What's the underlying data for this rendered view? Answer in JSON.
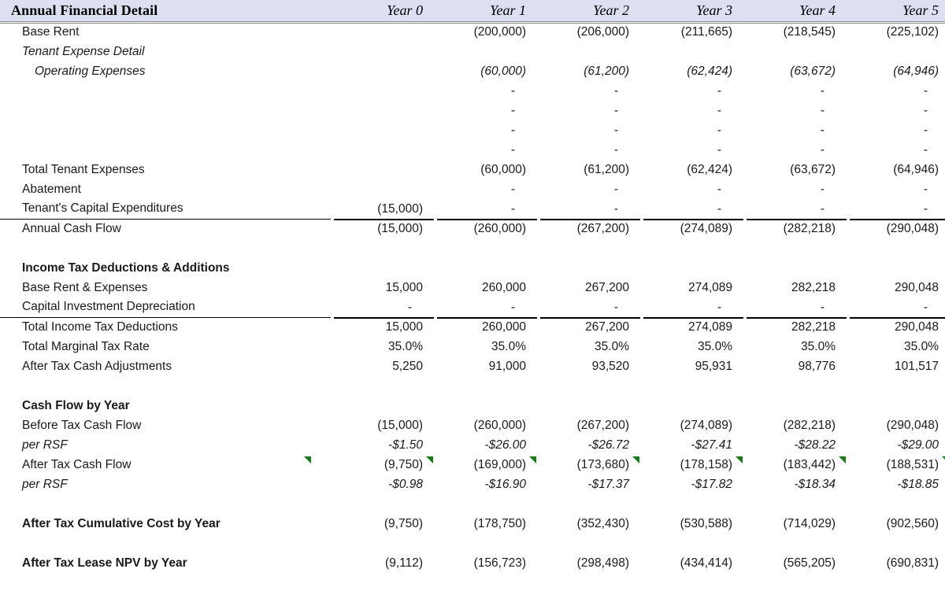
{
  "header": {
    "title": "Annual Financial Detail",
    "years": [
      "Year 0",
      "Year 1",
      "Year 2",
      "Year 3",
      "Year 4",
      "Year 5"
    ]
  },
  "colors": {
    "header_background": "#dce0f0",
    "header_rule": "#8a8a8a",
    "comment_flag_green": "#1a7a1a",
    "text": "#1a1a1a"
  },
  "rows": {
    "base_rent": {
      "label": "Base Rent",
      "values": [
        "",
        "(200,000)",
        "(206,000)",
        "(211,665)",
        "(218,545)",
        "(225,102)"
      ]
    },
    "tenant_expense_detail": {
      "label": "Tenant Expense Detail",
      "values": [
        "",
        "",
        "",
        "",
        "",
        ""
      ]
    },
    "operating_expenses": {
      "label": "Operating Expenses",
      "values": [
        "",
        "(60,000)",
        "(61,200)",
        "(62,424)",
        "(63,672)",
        "(64,946)"
      ]
    },
    "blank_expense_1": {
      "label": "",
      "values": [
        "",
        "-",
        "-",
        "-",
        "-",
        "-"
      ]
    },
    "blank_expense_2": {
      "label": "",
      "values": [
        "",
        "-",
        "-",
        "-",
        "-",
        "-"
      ]
    },
    "blank_expense_3": {
      "label": "",
      "values": [
        "",
        "-",
        "-",
        "-",
        "-",
        "-"
      ]
    },
    "blank_expense_4": {
      "label": "",
      "values": [
        "",
        "-",
        "-",
        "-",
        "-",
        "-"
      ]
    },
    "total_tenant_expenses": {
      "label": "Total Tenant Expenses",
      "values": [
        "",
        "(60,000)",
        "(61,200)",
        "(62,424)",
        "(63,672)",
        "(64,946)"
      ]
    },
    "abatement": {
      "label": "Abatement",
      "values": [
        "",
        "-",
        "-",
        "-",
        "-",
        "-"
      ]
    },
    "tenants_capital_expenditures": {
      "label": "Tenant's Capital Expenditures",
      "values": [
        "(15,000)",
        "-",
        "-",
        "-",
        "-",
        "-"
      ]
    },
    "annual_cash_flow": {
      "label": "Annual Cash Flow",
      "values": [
        "(15,000)",
        "(260,000)",
        "(267,200)",
        "(274,089)",
        "(282,218)",
        "(290,048)"
      ]
    },
    "income_tax_section": {
      "label": "Income Tax Deductions & Additions",
      "values": [
        "",
        "",
        "",
        "",
        "",
        ""
      ]
    },
    "base_rent_and_expenses": {
      "label": "Base Rent & Expenses",
      "values": [
        "15,000",
        "260,000",
        "267,200",
        "274,089",
        "282,218",
        "290,048"
      ]
    },
    "capital_investment_depreciation": {
      "label": "Capital Investment Depreciation",
      "values": [
        "-",
        "-",
        "-",
        "-",
        "-",
        "-"
      ]
    },
    "total_income_tax_deductions": {
      "label": "Total Income Tax Deductions",
      "values": [
        "15,000",
        "260,000",
        "267,200",
        "274,089",
        "282,218",
        "290,048"
      ]
    },
    "total_marginal_tax_rate": {
      "label": "Total Marginal Tax Rate",
      "values": [
        "35.0%",
        "35.0%",
        "35.0%",
        "35.0%",
        "35.0%",
        "35.0%"
      ]
    },
    "after_tax_cash_adjustments": {
      "label": "After Tax Cash Adjustments",
      "values": [
        "5,250",
        "91,000",
        "93,520",
        "95,931",
        "98,776",
        "101,517"
      ]
    },
    "cash_flow_section": {
      "label": "Cash Flow by Year",
      "values": [
        "",
        "",
        "",
        "",
        "",
        ""
      ]
    },
    "before_tax_cash_flow": {
      "label": "Before Tax Cash Flow",
      "values": [
        "(15,000)",
        "(260,000)",
        "(267,200)",
        "(274,089)",
        "(282,218)",
        "(290,048)"
      ]
    },
    "before_tax_per_rsf": {
      "label": "per RSF",
      "values": [
        "-$1.50",
        "-$26.00",
        "-$26.72",
        "-$27.41",
        "-$28.22",
        "-$29.00"
      ]
    },
    "after_tax_cash_flow": {
      "label": "After Tax Cash Flow",
      "values": [
        "(9,750)",
        "(169,000)",
        "(173,680)",
        "(178,158)",
        "(183,442)",
        "(188,531)"
      ]
    },
    "after_tax_per_rsf": {
      "label": "per RSF",
      "values": [
        "-$0.98",
        "-$16.90",
        "-$17.37",
        "-$17.82",
        "-$18.34",
        "-$18.85"
      ]
    },
    "after_tax_cumulative_cost": {
      "label": "After Tax Cumulative Cost by Year",
      "values": [
        "(9,750)",
        "(178,750)",
        "(352,430)",
        "(530,588)",
        "(714,029)",
        "(902,560)"
      ]
    },
    "after_tax_lease_npv": {
      "label": "After Tax Lease NPV by Year",
      "values": [
        "(9,112)",
        "(156,723)",
        "(298,498)",
        "(434,414)",
        "(565,205)",
        "(690,831)"
      ]
    }
  }
}
